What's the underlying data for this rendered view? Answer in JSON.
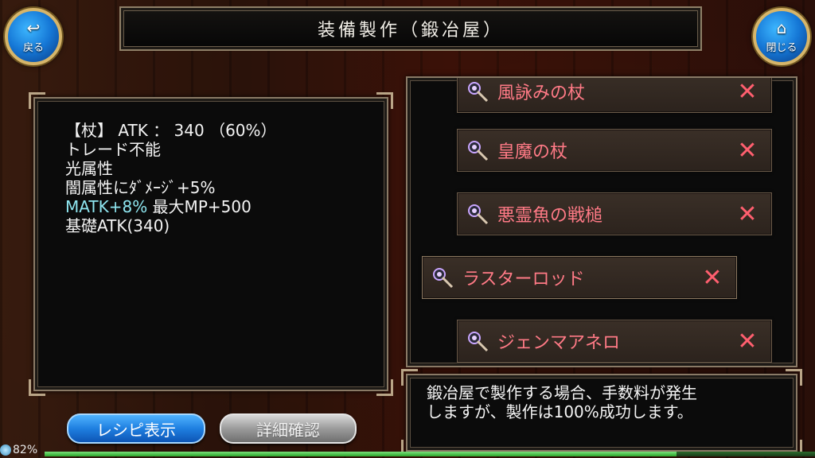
{
  "header": {
    "title": "装備製作（鍛冶屋）",
    "back_label": "戻る",
    "close_label": "閉じる"
  },
  "item_stats": {
    "line1": "【杖】 ATK ： 340 （60%）",
    "line2": "トレード不能",
    "line3": "光属性",
    "line4": "闇属性にﾀﾞﾒｰｼﾞ+5%",
    "line5_highlight": "MATK+8%",
    "line5_rest": " 最大MP+500",
    "line6": "基礎ATK(340)"
  },
  "recipes": [
    {
      "name": "風詠みの杖",
      "remove": "✕",
      "icon": "staff-icon"
    },
    {
      "name": "皇魔の杖",
      "remove": "✕",
      "icon": "staff-icon"
    },
    {
      "name": "悪霊魚の戦槌",
      "remove": "✕",
      "icon": "staff-icon"
    },
    {
      "name": "ラスターロッド",
      "remove": "✕",
      "icon": "staff-icon",
      "selected": true
    },
    {
      "name": "ジェンマアネロ",
      "remove": "✕",
      "icon": "staff-icon"
    }
  ],
  "info": {
    "line1": "鍛冶屋で製作する場合、手数料が発生",
    "line2": "しますが、製作は100%成功します。"
  },
  "buttons": {
    "recipe_display": "レシピ表示",
    "detail_confirm": "詳細確認"
  },
  "status": {
    "battery": "82%",
    "battery_level": 0.82
  },
  "colors": {
    "recipe_text": "#ff7a86",
    "highlight_stat": "#8ee6f0",
    "primary_button": "#1f7fe0"
  }
}
